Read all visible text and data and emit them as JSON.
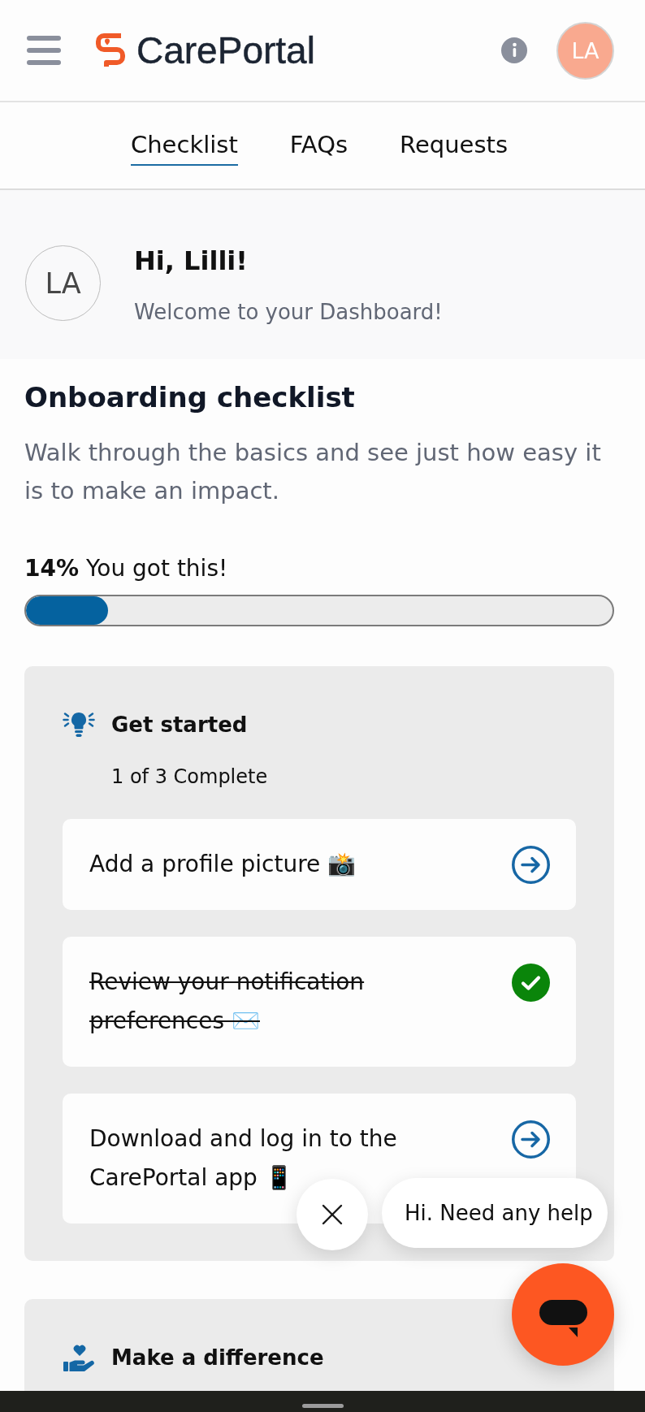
{
  "header": {
    "logo": "CarePortal",
    "avatar_initials": "LA"
  },
  "tabs": [
    {
      "label": "Checklist",
      "selected": true
    },
    {
      "label": "FAQs",
      "selected": false
    },
    {
      "label": "Requests",
      "selected": false
    }
  ],
  "greeting": {
    "avatar_initials": "LA",
    "title": "Hi, Lilli!",
    "subtitle": "Welcome to your Dashboard!"
  },
  "checklist": {
    "title": "Onboarding checklist",
    "description": "Walk through the basics and see just how easy it is to make an impact.",
    "progress": {
      "label": "**14%** You got this!",
      "level": 0.14
    },
    "sections": [
      {
        "kind": "tips",
        "title": "Get started",
        "summary": "1 of 3 Complete",
        "tasks": [
          {
            "label": "Add a profile picture 📸",
            "completed": false
          },
          {
            "label": "Review your notification preferences ✉️",
            "completed": true
          },
          {
            "label": "Download and log in to the CarePortal app 📱",
            "completed": false
          }
        ]
      },
      {
        "kind": "giving",
        "title": "Make a difference"
      }
    ]
  },
  "chat": {
    "message": "Hi. Need any help"
  }
}
